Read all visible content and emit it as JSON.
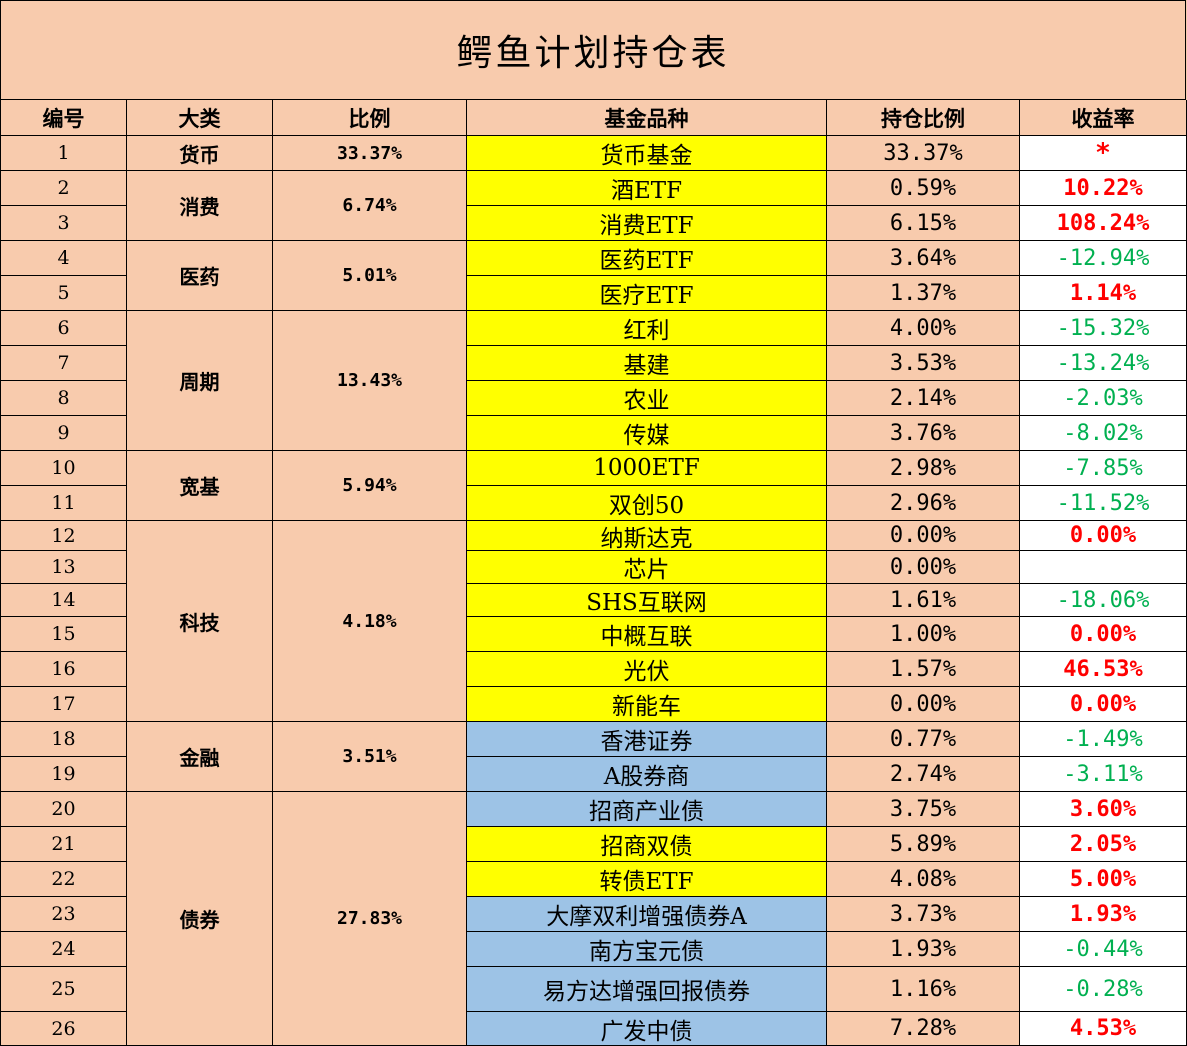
{
  "title": "鳄鱼计划持仓表",
  "headers": [
    "编号",
    "大类",
    "比例",
    "基金品种",
    "持仓比例",
    "收益率"
  ],
  "categories": [
    {
      "name": "货币",
      "ratio": "33.37%"
    },
    {
      "name": "消费",
      "ratio": "6.74%"
    },
    {
      "name": "医药",
      "ratio": "5.01%"
    },
    {
      "name": "周期",
      "ratio": "13.43%"
    },
    {
      "name": "宽基",
      "ratio": "5.94%"
    },
    {
      "name": "科技",
      "ratio": "4.18%"
    },
    {
      "name": "金融",
      "ratio": "3.51%"
    },
    {
      "name": "债券",
      "ratio": "27.83%"
    }
  ],
  "rows": [
    {
      "no": "1",
      "fund": "货币基金",
      "holding": "33.37%",
      "return": "*",
      "fund_color": "yellow",
      "return_color": "star"
    },
    {
      "no": "2",
      "fund": "酒ETF",
      "holding": "0.59%",
      "return": "10.22%",
      "fund_color": "yellow",
      "return_color": "red"
    },
    {
      "no": "3",
      "fund": "消费ETF",
      "holding": "6.15%",
      "return": "108.24%",
      "fund_color": "yellow",
      "return_color": "red"
    },
    {
      "no": "4",
      "fund": "医药ETF",
      "holding": "3.64%",
      "return": "-12.94%",
      "fund_color": "yellow",
      "return_color": "green"
    },
    {
      "no": "5",
      "fund": "医疗ETF",
      "holding": "1.37%",
      "return": "1.14%",
      "fund_color": "yellow",
      "return_color": "red"
    },
    {
      "no": "6",
      "fund": "红利",
      "holding": "4.00%",
      "return": "-15.32%",
      "fund_color": "yellow",
      "return_color": "green"
    },
    {
      "no": "7",
      "fund": "基建",
      "holding": "3.53%",
      "return": "-13.24%",
      "fund_color": "yellow",
      "return_color": "green"
    },
    {
      "no": "8",
      "fund": "农业",
      "holding": "2.14%",
      "return": "-2.03%",
      "fund_color": "yellow",
      "return_color": "green"
    },
    {
      "no": "9",
      "fund": "传媒",
      "holding": "3.76%",
      "return": "-8.02%",
      "fund_color": "yellow",
      "return_color": "green"
    },
    {
      "no": "10",
      "fund": "1000ETF",
      "holding": "2.98%",
      "return": "-7.85%",
      "fund_color": "yellow",
      "return_color": "green"
    },
    {
      "no": "11",
      "fund": "双创50",
      "holding": "2.96%",
      "return": "-11.52%",
      "fund_color": "yellow",
      "return_color": "green"
    },
    {
      "no": "12",
      "fund": "纳斯达克",
      "holding": "0.00%",
      "return": "0.00%",
      "fund_color": "yellow",
      "return_color": "red"
    },
    {
      "no": "13",
      "fund": "芯片",
      "holding": "0.00%",
      "return": "",
      "fund_color": "yellow",
      "return_color": "red"
    },
    {
      "no": "14",
      "fund": "SHS互联网",
      "holding": "1.61%",
      "return": "-18.06%",
      "fund_color": "yellow",
      "return_color": "green"
    },
    {
      "no": "15",
      "fund": "中概互联",
      "holding": "1.00%",
      "return": "0.00%",
      "fund_color": "yellow",
      "return_color": "red"
    },
    {
      "no": "16",
      "fund": "光伏",
      "holding": "1.57%",
      "return": "46.53%",
      "fund_color": "yellow",
      "return_color": "red"
    },
    {
      "no": "17",
      "fund": "新能车",
      "holding": "0.00%",
      "return": "0.00%",
      "fund_color": "yellow",
      "return_color": "red"
    },
    {
      "no": "18",
      "fund": "香港证券",
      "holding": "0.77%",
      "return": "-1.49%",
      "fund_color": "blue",
      "return_color": "green"
    },
    {
      "no": "19",
      "fund": "A股券商",
      "holding": "2.74%",
      "return": "-3.11%",
      "fund_color": "blue",
      "return_color": "green"
    },
    {
      "no": "20",
      "fund": "招商产业债",
      "holding": "3.75%",
      "return": "3.60%",
      "fund_color": "blue",
      "return_color": "red"
    },
    {
      "no": "21",
      "fund": "招商双债",
      "holding": "5.89%",
      "return": "2.05%",
      "fund_color": "yellow",
      "return_color": "red"
    },
    {
      "no": "22",
      "fund": "转债ETF",
      "holding": "4.08%",
      "return": "5.00%",
      "fund_color": "yellow",
      "return_color": "red"
    },
    {
      "no": "23",
      "fund": "大摩双利增强债券A",
      "holding": "3.73%",
      "return": "1.93%",
      "fund_color": "blue",
      "return_color": "red"
    },
    {
      "no": "24",
      "fund": "南方宝元债",
      "holding": "1.93%",
      "return": "-0.44%",
      "fund_color": "blue",
      "return_color": "green"
    },
    {
      "no": "25",
      "fund": "易方达增强回报债券",
      "holding": "1.16%",
      "return": "-0.28%",
      "fund_color": "blue",
      "return_color": "green"
    },
    {
      "no": "26",
      "fund": "广发中债",
      "holding": "7.28%",
      "return": "4.53%",
      "fund_color": "blue",
      "return_color": "red"
    }
  ],
  "colors": {
    "sheet_bg": "#f8cbad",
    "yellow": "#ffff00",
    "blue": "#9dc3e6",
    "red_text": "#ff0000",
    "green_text": "#00b050"
  }
}
